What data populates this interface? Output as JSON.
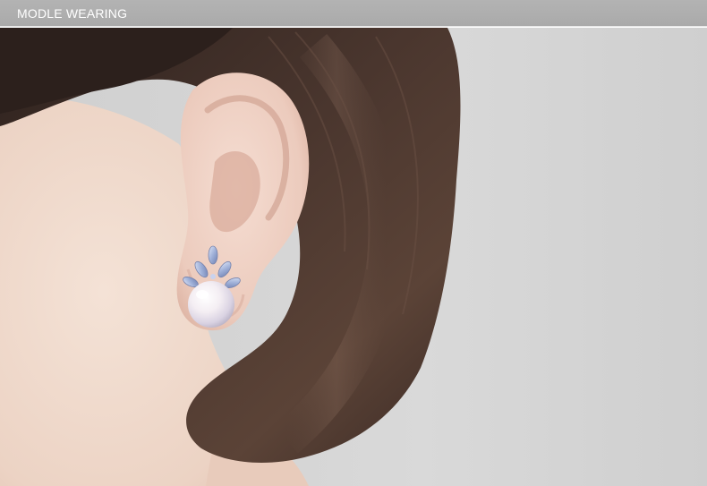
{
  "header": {
    "title": "MODLE WEARING"
  },
  "image": {
    "subject": "model-ear-pearl-earring",
    "colors": {
      "background": "#d6d6d6",
      "hair": "#3b2b25",
      "skin": "#efd9cc",
      "pearl": "#f4eef2",
      "crystal": "#a7b5d8"
    }
  }
}
